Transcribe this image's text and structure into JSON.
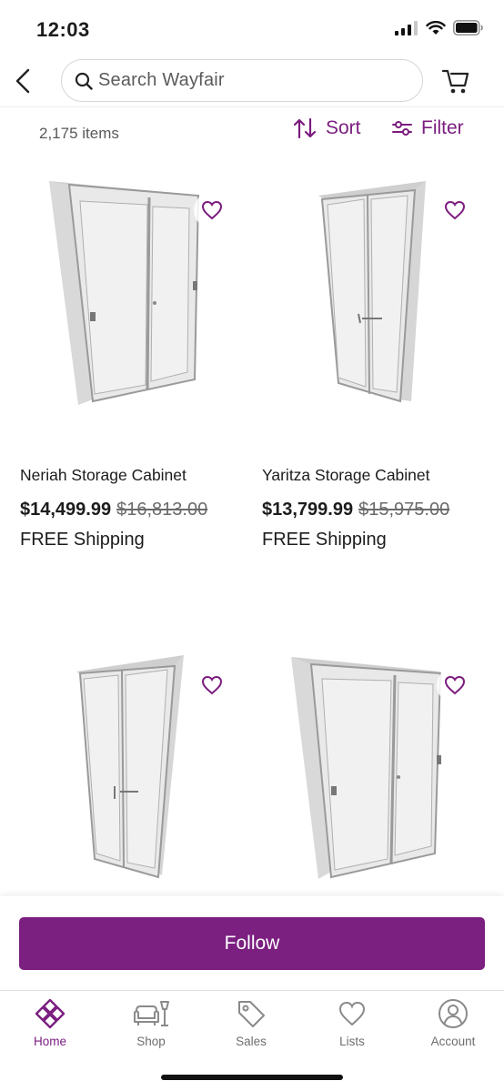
{
  "status_bar": {
    "time": "12:03"
  },
  "header": {
    "search_placeholder": "Search Wayfair"
  },
  "toolbar": {
    "item_count": "2,175 items",
    "sort_label": "Sort",
    "filter_label": "Filter"
  },
  "products": [
    {
      "name": "Neriah Storage Cabinet",
      "price": "$14,499.99",
      "original_price": "$16,813.00",
      "shipping": "FREE Shipping"
    },
    {
      "name": "Yaritza Storage Cabinet",
      "price": "$13,799.99",
      "original_price": "$15,975.00",
      "shipping": "FREE Shipping"
    },
    {
      "name": "",
      "price": "",
      "original_price": "",
      "shipping": ""
    },
    {
      "name": "",
      "price": "",
      "original_price": "",
      "shipping": ""
    }
  ],
  "follow_label": "Follow",
  "bottom_nav": [
    {
      "label": "Home",
      "icon": "home-icon",
      "active": true
    },
    {
      "label": "Shop",
      "icon": "shop-icon",
      "active": false
    },
    {
      "label": "Sales",
      "icon": "tag-icon",
      "active": false
    },
    {
      "label": "Lists",
      "icon": "heart-icon",
      "active": false
    },
    {
      "label": "Account",
      "icon": "account-icon",
      "active": false
    }
  ],
  "colors": {
    "brand": "#7b1f80",
    "accent_text": "#7b1c7e"
  }
}
